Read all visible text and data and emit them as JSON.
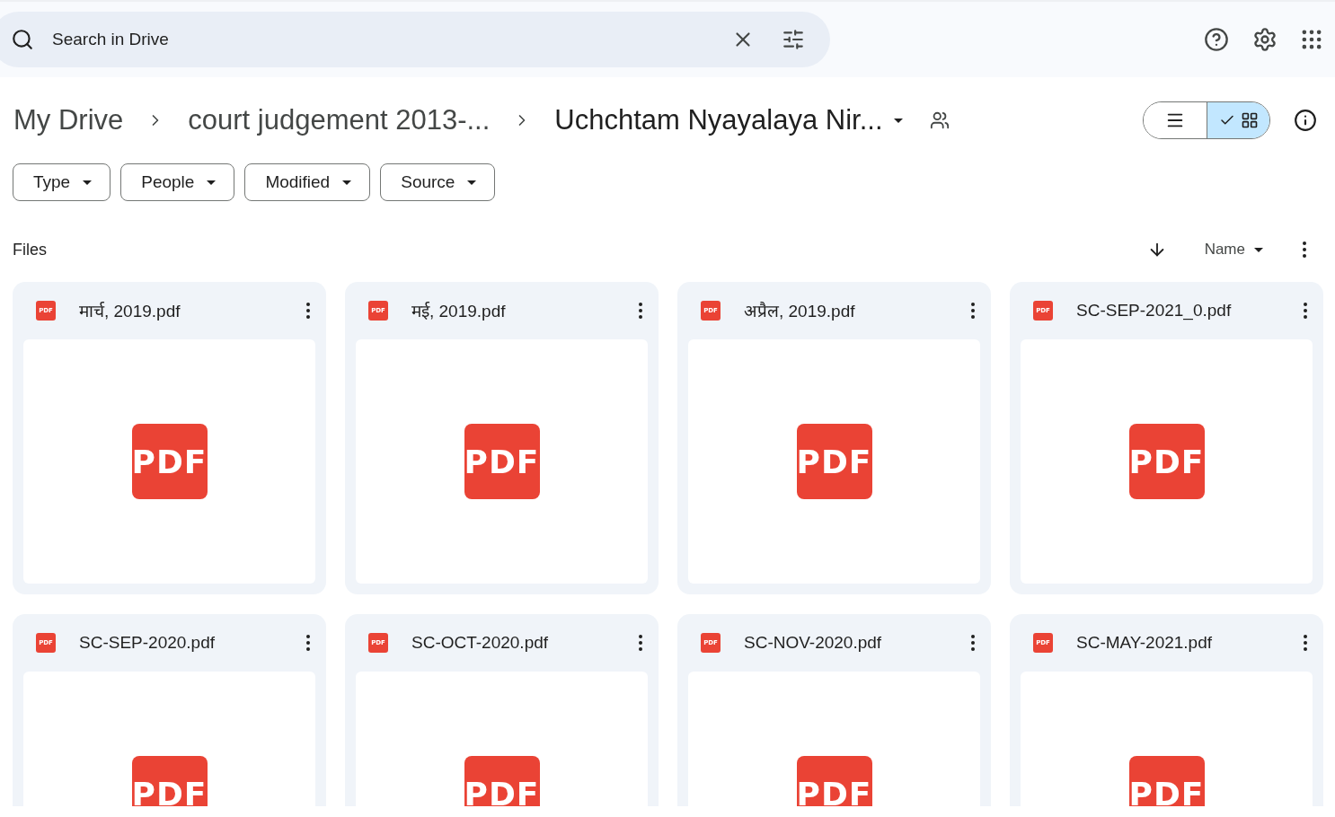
{
  "search": {
    "placeholder": "Search in Drive"
  },
  "breadcrumbs": [
    {
      "label": "My Drive",
      "current": false
    },
    {
      "label": "court judgement 2013-...",
      "current": false
    },
    {
      "label": "Uchchtam Nyayalaya Nir...",
      "current": true
    }
  ],
  "view_toggle": [
    {
      "kind": "list",
      "selected": false
    },
    {
      "kind": "grid",
      "selected": true
    }
  ],
  "filters": [
    "Type",
    "People",
    "Modified",
    "Source"
  ],
  "section_title": "Files",
  "sort": {
    "label": "Name"
  },
  "files": [
    {
      "name": "मार्च, 2019.pdf",
      "badge": "PDF",
      "preview": "PDF"
    },
    {
      "name": "मई, 2019.pdf",
      "badge": "PDF",
      "preview": "PDF"
    },
    {
      "name": "अप्रैल, 2019.pdf",
      "badge": "PDF",
      "preview": "PDF"
    },
    {
      "name": "SC-SEP-2021_0.pdf",
      "badge": "PDF",
      "preview": "PDF"
    },
    {
      "name": "SC-SEP-2020.pdf",
      "badge": "PDF",
      "preview": "PDF"
    },
    {
      "name": "SC-OCT-2020.pdf",
      "badge": "PDF",
      "preview": "PDF"
    },
    {
      "name": "SC-NOV-2020.pdf",
      "badge": "PDF",
      "preview": "PDF"
    },
    {
      "name": "SC-MAY-2021.pdf",
      "badge": "PDF",
      "preview": "PDF"
    }
  ]
}
